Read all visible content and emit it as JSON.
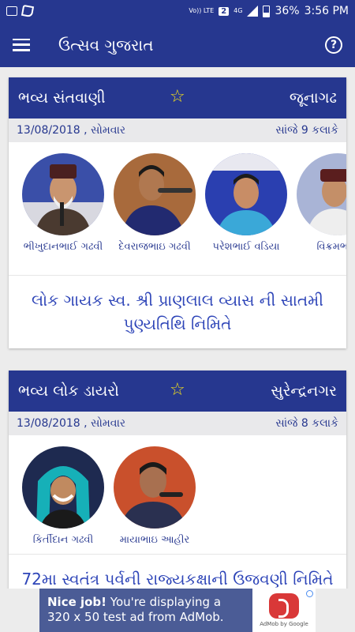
{
  "status": {
    "volte": "Vo)) LTE",
    "sim": "2",
    "network": "4G",
    "battery": "36%",
    "time": "3:56 PM"
  },
  "app": {
    "title": "ઉત્સવ ગુજરાત"
  },
  "cards": [
    {
      "title": "ભવ્ય સંતવાણી",
      "city": "જૂનાગઢ",
      "date": "13/08/2018 , સોમવાર",
      "time": "સાંજે 9 કલાકે",
      "artists": [
        {
          "name": "ભીખુદાનભાઈ ગઢવી"
        },
        {
          "name": "દેવરાજભાઇ ગઢવી"
        },
        {
          "name": "પરેશભાઈ વડિયા"
        },
        {
          "name": "વિક્રમભાઈ"
        }
      ],
      "description": "લોક ગાયક સ્વ. શ્રી પ્રાણલાલ વ્યાસ ની સાતમી પુણ્યતિથિ નિમિતે"
    },
    {
      "title": "ભવ્ય લોક ડાયરો",
      "city": "સુરેન્દ્રનગર",
      "date": "13/08/2018 , સોમવાર",
      "time": "સાંજે 8 કલાકે",
      "artists": [
        {
          "name": "કિર્તીદાન ગઢવી"
        },
        {
          "name": "માયાભાઇ આહીર"
        }
      ],
      "description": "72મા સ્વતંત્ર પર્વની રાજ્યકક્ષાની ઉજવણી નિમિતે"
    }
  ],
  "ad": {
    "headline": "Nice job!",
    "body": "You're displaying a 320 x 50 test ad from AdMob.",
    "logo_text": "AdMob by Google"
  }
}
